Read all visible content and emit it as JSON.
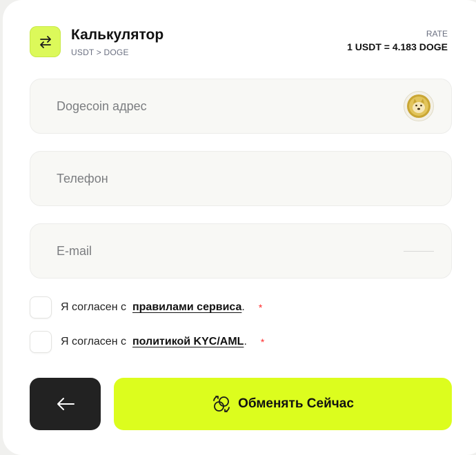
{
  "header": {
    "title": "Калькулятор",
    "pair": "USDT > DOGE",
    "rate_label": "RATE",
    "rate_value": "1 USDT = 4.183 DOGE",
    "icon": "swap-arrows-icon"
  },
  "form": {
    "address_placeholder": "Dogecoin адрес",
    "address_icon": "dogecoin-logo",
    "phone_placeholder": "Телефон",
    "email_placeholder": "E-mail"
  },
  "agreements": [
    {
      "prefix": "Я согласен с",
      "link": "правилами сервиса",
      "suffix": ".",
      "required": "*"
    },
    {
      "prefix": "Я согласен с",
      "link": "политикой KYC/AML",
      "suffix": ".",
      "required": "*"
    }
  ],
  "actions": {
    "back_icon": "arrow-left-icon",
    "exchange_label": "Обменять Сейчас",
    "exchange_icon": "exchange-circles-icon"
  },
  "colors": {
    "accent": "#dcfd1e",
    "dark_button": "#222222",
    "required": "#ff2a2a"
  }
}
